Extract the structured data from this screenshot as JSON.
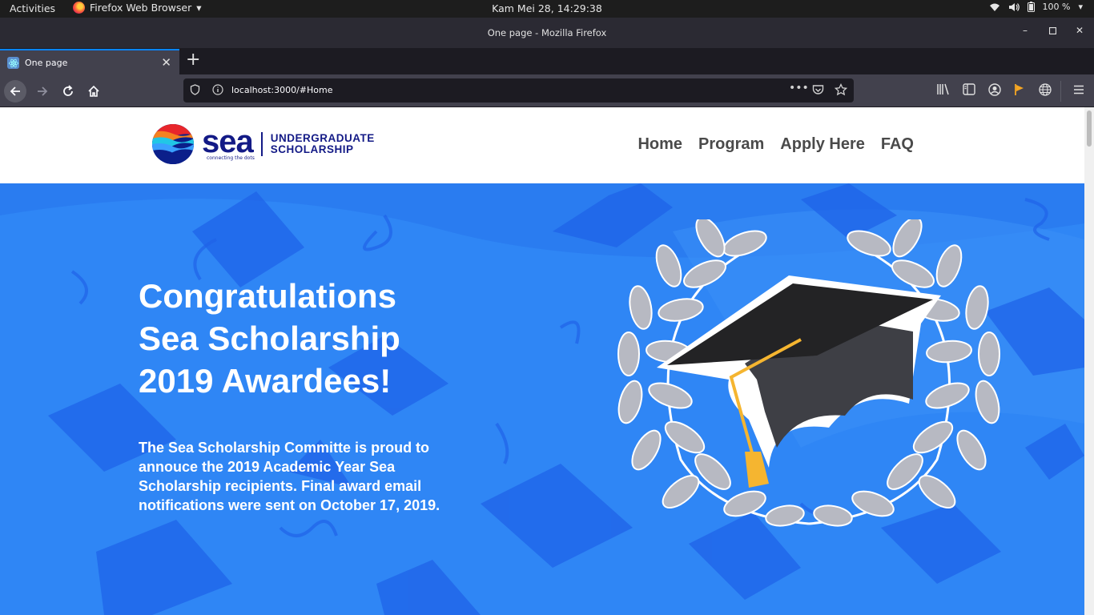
{
  "system": {
    "activities": "Activities",
    "app_name": "Firefox Web Browser",
    "clock": "Kam Mei 28, 14:29:38",
    "battery": "100 %"
  },
  "window": {
    "title": "One page - Mozilla Firefox"
  },
  "tabs": [
    {
      "label": "One page",
      "active": true
    }
  ],
  "navbar": {
    "url": "localhost:3000/#Home"
  },
  "site": {
    "logo_word": "sea",
    "logo_tagline": "connecting the dots",
    "logo_sub_line1": "UNDERGRADUATE",
    "logo_sub_line2": "SCHOLARSHIP",
    "nav": [
      "Home",
      "Program",
      "Apply Here",
      "FAQ"
    ]
  },
  "hero": {
    "heading_line1": "Congratulations",
    "heading_line2": "Sea Scholarship",
    "heading_line3": "2019 Awardees!",
    "body": "The Sea Scholarship Committe is proud to annouce the 2019 Academic Year Sea Scholarship recipients. Final award email notifications were sent on October 17, 2019."
  },
  "colors": {
    "hero_bg": "#2f86f5",
    "brand_navy": "#131a86",
    "accent_gold": "#f5b530"
  }
}
